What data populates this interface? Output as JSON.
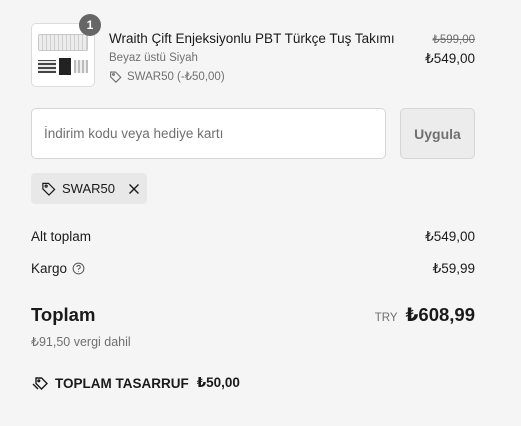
{
  "product": {
    "quantity": "1",
    "title": "Wraith Çift Enjeksiyonlu PBT Türkçe Tuş Takımı",
    "variant": "Beyaz üstü Siyah",
    "applied_discount": "SWAR50 (-₺50,00)",
    "original_price": "₺599,00",
    "price": "₺549,00"
  },
  "discount_form": {
    "placeholder": "İndirim kodu veya hediye kartı",
    "value": "",
    "apply_label": "Uygula"
  },
  "applied_code": {
    "label": "SWAR50"
  },
  "summary": {
    "subtotal_label": "Alt toplam",
    "subtotal_value": "₺549,00",
    "shipping_label": "Kargo",
    "shipping_value": "₺59,99",
    "total_label": "Toplam",
    "currency": "TRY",
    "total_value": "₺608,99",
    "tax_note": "₺91,50 vergi dahil",
    "savings_label": "TOPLAM TASARRUF",
    "savings_value": "₺50,00"
  },
  "icons": {
    "tag": "tag-icon",
    "close": "close-icon",
    "help": "help-icon",
    "savings_tags": "tags-icon"
  }
}
